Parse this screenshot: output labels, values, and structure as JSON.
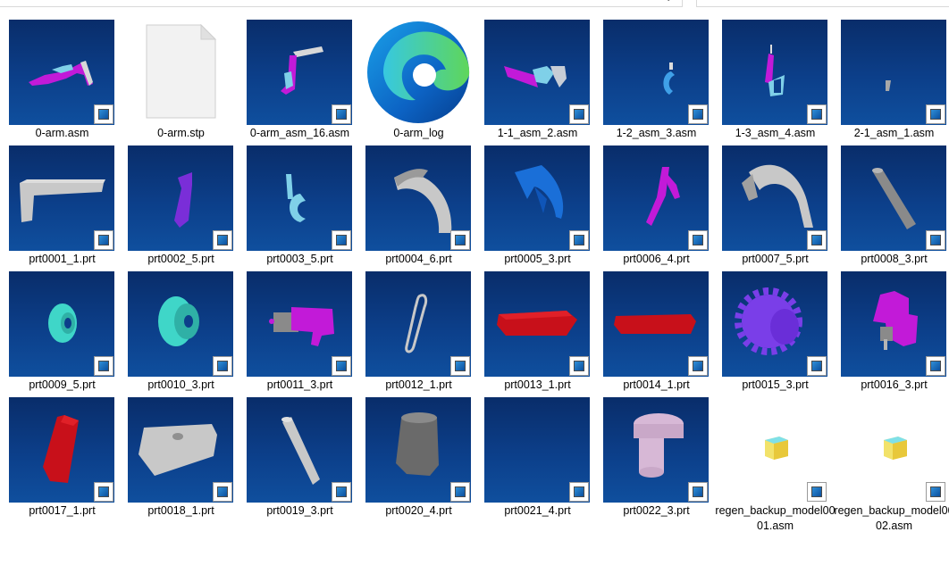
{
  "files": [
    {
      "name": "0-arm.asm"
    },
    {
      "name": "0-arm.stp"
    },
    {
      "name": "0-arm_asm_16.asm"
    },
    {
      "name": "0-arm_log"
    },
    {
      "name": "1-1_asm_2.asm"
    },
    {
      "name": "1-2_asm_3.asm"
    },
    {
      "name": "1-3_asm_4.asm"
    },
    {
      "name": "2-1_asm_1.asm"
    },
    {
      "name": "prt0001_1.prt"
    },
    {
      "name": "prt0002_5.prt"
    },
    {
      "name": "prt0003_5.prt"
    },
    {
      "name": "prt0004_6.prt"
    },
    {
      "name": "prt0005_3.prt"
    },
    {
      "name": "prt0006_4.prt"
    },
    {
      "name": "prt0007_5.prt"
    },
    {
      "name": "prt0008_3.prt"
    },
    {
      "name": "prt0009_5.prt"
    },
    {
      "name": "prt0010_3.prt"
    },
    {
      "name": "prt0011_3.prt"
    },
    {
      "name": "prt0012_1.prt"
    },
    {
      "name": "prt0013_1.prt"
    },
    {
      "name": "prt0014_1.prt"
    },
    {
      "name": "prt0015_3.prt"
    },
    {
      "name": "prt0016_3.prt"
    },
    {
      "name": "prt0017_1.prt"
    },
    {
      "name": "prt0018_1.prt"
    },
    {
      "name": "prt0019_3.prt"
    },
    {
      "name": "prt0020_4.prt"
    },
    {
      "name": "prt0021_4.prt"
    },
    {
      "name": "prt0022_3.prt"
    },
    {
      "name": "regen_backup_model0001.asm"
    },
    {
      "name": "regen_backup_model0002.asm"
    }
  ],
  "colors": {
    "thumb_bg_top": "#092d6a",
    "thumb_bg_bottom": "#0f4f9e",
    "part_magenta": "#c21ad8",
    "part_gray": "#c8c8c8",
    "part_cyan": "#3fd6c8",
    "part_red": "#c8101a",
    "part_purple": "#7a3ee8",
    "part_pink": "#d7b8d6"
  }
}
